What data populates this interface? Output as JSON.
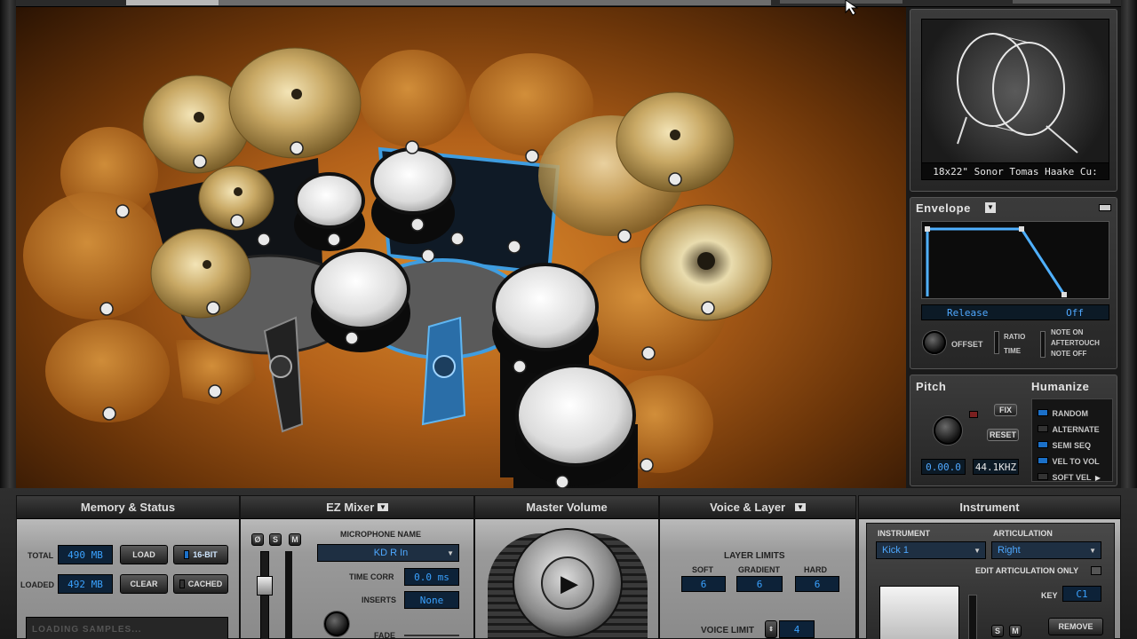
{
  "kit_preview": {
    "caption": "18x22\" Sonor Tomas Haake Cu:"
  },
  "envelope": {
    "title": "Envelope",
    "release_label": "Release",
    "release_value": "Off",
    "offset_label": "OFFSET",
    "ratio_label": "RATIO",
    "time_label": "TIME",
    "note_on": "NOTE ON",
    "aftertouch": "AFTERTOUCH",
    "note_off": "NOTE OFF"
  },
  "pitch": {
    "title": "Pitch",
    "fix": "FIX",
    "reset": "RESET",
    "value": "0.00.0",
    "rate": "44.1KHZ"
  },
  "humanize": {
    "title": "Humanize",
    "options": [
      {
        "label": "RANDOM",
        "active": true
      },
      {
        "label": "ALTERNATE",
        "active": false
      },
      {
        "label": "SEMI SEQ",
        "active": true
      },
      {
        "label": "VEL TO VOL",
        "active": true
      },
      {
        "label": "SOFT VEL",
        "active": false
      }
    ]
  },
  "memory": {
    "title": "Memory & Status",
    "total_label": "TOTAL",
    "total_value": "490 MB",
    "loaded_label": "LOADED",
    "loaded_value": "492 MB",
    "load": "LOAD",
    "bit16": "16-BIT",
    "clear": "CLEAR",
    "cached": "CACHED",
    "status": "LOADING SAMPLES..."
  },
  "mixer": {
    "title": "EZ Mixer",
    "mute": "Ø",
    "solo": "S",
    "m": "M",
    "mic_label": "MICROPHONE NAME",
    "mic_value": "KD R In",
    "timecorr_label": "TIME CORR",
    "timecorr_value": "0.0 ms",
    "inserts_label": "INSERTS",
    "inserts_value": "None",
    "fade_label": "FADE"
  },
  "master": {
    "title": "Master Volume"
  },
  "voice": {
    "title": "Voice & Layer",
    "layer_limits": "LAYER LIMITS",
    "soft_label": "SOFT",
    "soft_value": "6",
    "gradient_label": "GRADIENT",
    "gradient_value": "6",
    "hard_label": "HARD",
    "hard_value": "6",
    "voice_limit_label": "VOICE LIMIT",
    "voice_limit_value": "4"
  },
  "instrument": {
    "title": "Instrument",
    "instrument_label": "INSTRUMENT",
    "instrument_value": "Kick 1",
    "articulation_label": "ARTICULATION",
    "articulation_value": "Right",
    "edit_only": "EDIT ARTICULATION ONLY",
    "key_label": "KEY",
    "key_value": "C1",
    "remove": "REMOVE",
    "s": "S",
    "m": "M"
  }
}
